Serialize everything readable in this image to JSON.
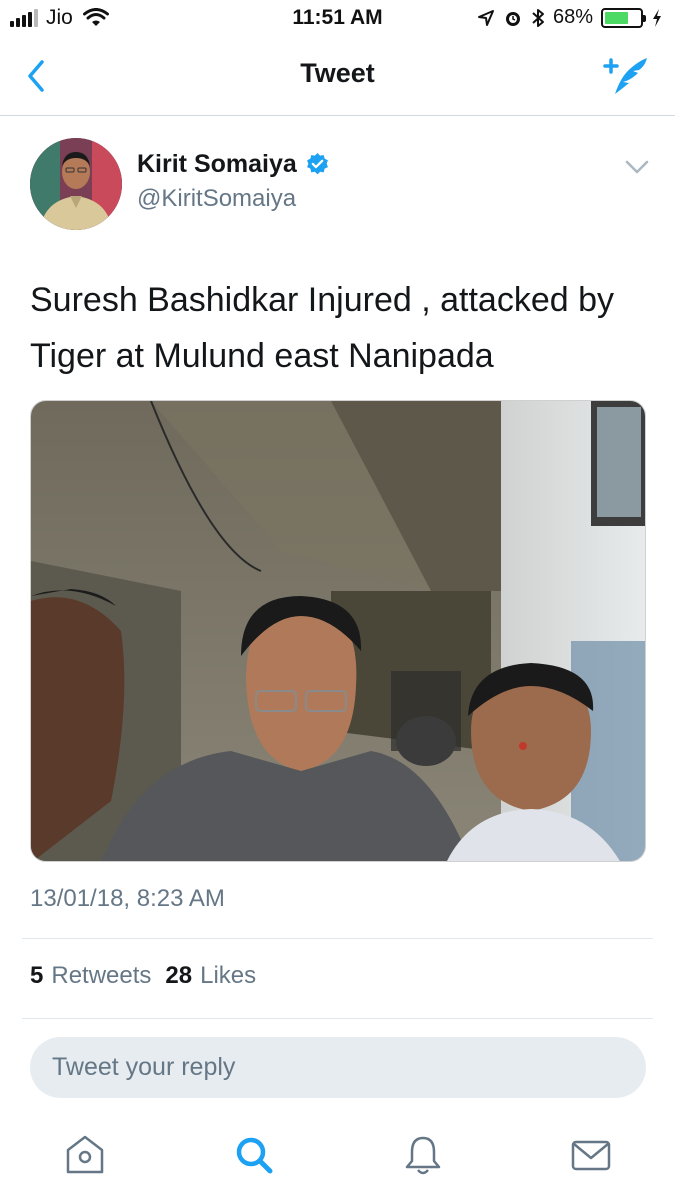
{
  "status_bar": {
    "carrier": "Jio",
    "time": "11:51 AM",
    "battery_percent": "68%",
    "battery_level": 0.68,
    "icons": [
      "signal-icon",
      "wifi-icon",
      "location-icon",
      "alarm-icon",
      "bluetooth-icon",
      "battery-icon",
      "charging-icon"
    ]
  },
  "nav": {
    "title": "Tweet",
    "back_icon": "chevron-left-icon",
    "compose_icon": "compose-tweet-icon"
  },
  "tweet": {
    "author_name": "Kirit Somaiya",
    "author_handle": "@KiritSomaiya",
    "verified": true,
    "text": "Suresh Bashidkar Injured  , attacked by Tiger at Mulund east Nanipada",
    "timestamp": "13/01/18, 8:23 AM",
    "retweets_count": "5",
    "retweets_label": "Retweets",
    "likes_count": "28",
    "likes_label": "Likes"
  },
  "reply": {
    "placeholder": "Tweet your reply"
  },
  "tab_bar": {
    "items": [
      "home-icon",
      "search-icon",
      "notifications-icon",
      "messages-icon"
    ]
  },
  "colors": {
    "accent": "#1da1f2",
    "secondary_text": "#657786",
    "primary_text": "#14171a",
    "battery": "#4cd964"
  }
}
